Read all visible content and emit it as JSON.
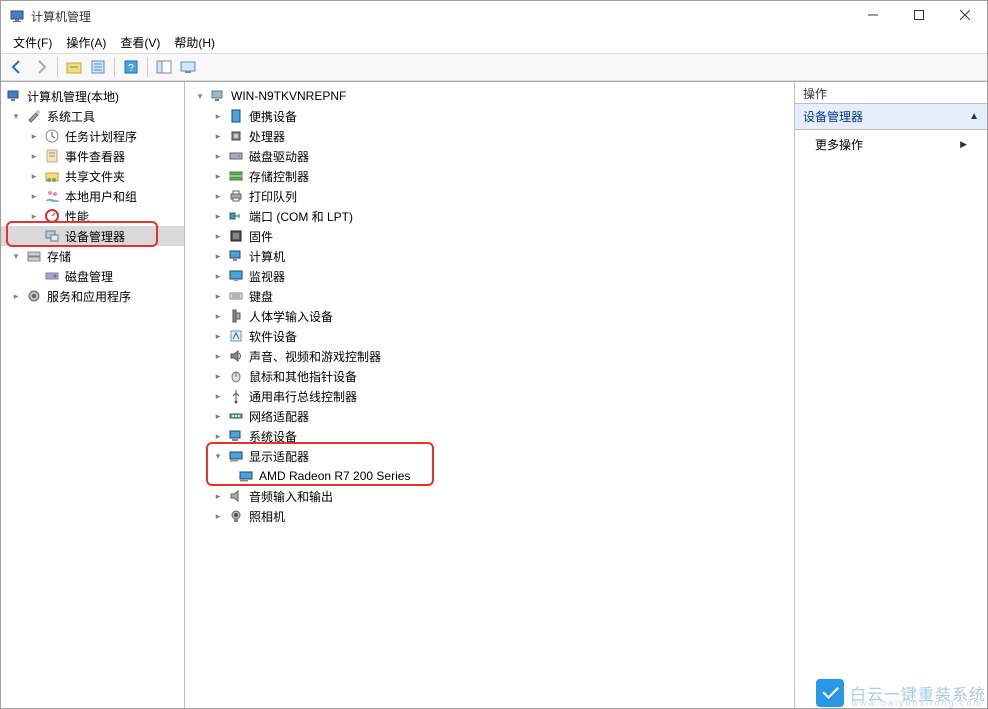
{
  "window": {
    "title": "计算机管理"
  },
  "menu": {
    "file": "文件(F)",
    "action": "操作(A)",
    "view": "查看(V)",
    "help": "帮助(H)"
  },
  "left_tree": {
    "root": "计算机管理(本地)",
    "system_tools": "系统工具",
    "task_scheduler": "任务计划程序",
    "event_viewer": "事件查看器",
    "shared_folders": "共享文件夹",
    "local_users": "本地用户和组",
    "performance": "性能",
    "device_manager": "设备管理器",
    "storage": "存储",
    "disk_mgmt": "磁盘管理",
    "services": "服务和应用程序"
  },
  "mid_tree": {
    "root": "WIN-N9TKVNREPNF",
    "portable": "便携设备",
    "cpu": "处理器",
    "disk_drives": "磁盘驱动器",
    "storage_ctrl": "存储控制器",
    "print_queue": "打印队列",
    "ports": "端口 (COM 和 LPT)",
    "firmware": "固件",
    "computer": "计算机",
    "monitor": "监视器",
    "keyboard": "键盘",
    "hid": "人体学输入设备",
    "software_dev": "软件设备",
    "sound": "声音、视频和游戏控制器",
    "mouse": "鼠标和其他指针设备",
    "usb": "通用串行总线控制器",
    "network": "网络适配器",
    "system_dev": "系统设备",
    "display": "显示适配器",
    "display_child": "AMD Radeon R7 200 Series",
    "audio_io": "音频输入和输出",
    "camera": "照相机"
  },
  "actions": {
    "header": "操作",
    "section": "设备管理器",
    "more": "更多操作"
  },
  "watermark": {
    "main": "白云一键重装系统",
    "sub": "www.baiyunxitong.com"
  }
}
